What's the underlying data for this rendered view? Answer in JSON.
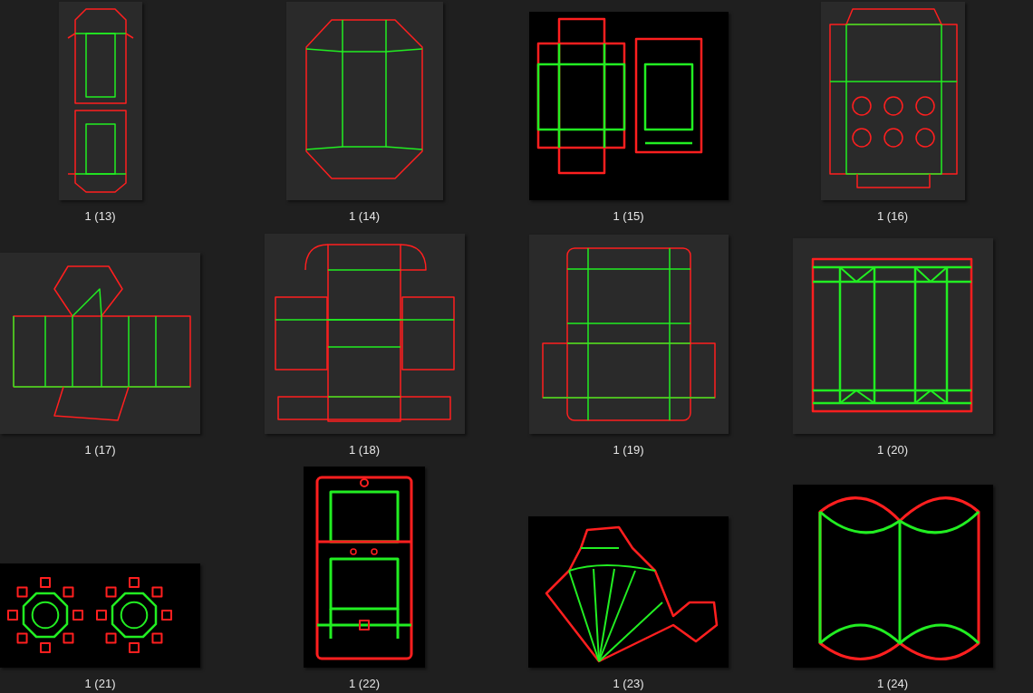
{
  "items": [
    {
      "label": "1 (13)",
      "kind": "tuck"
    },
    {
      "label": "1 (14)",
      "kind": "tray"
    },
    {
      "label": "1 (15)",
      "kind": "double"
    },
    {
      "label": "1 (16)",
      "kind": "cupcake"
    },
    {
      "label": "1 (17)",
      "kind": "hexagon"
    },
    {
      "label": "1 (18)",
      "kind": "mailer"
    },
    {
      "label": "1 (19)",
      "kind": "roll"
    },
    {
      "label": "1 (20)",
      "kind": "sleeve"
    },
    {
      "label": "1 (21)",
      "kind": "octagon"
    },
    {
      "label": "1 (22)",
      "kind": "window"
    },
    {
      "label": "1 (23)",
      "kind": "fan"
    },
    {
      "label": "1 (24)",
      "kind": "pillow"
    }
  ]
}
